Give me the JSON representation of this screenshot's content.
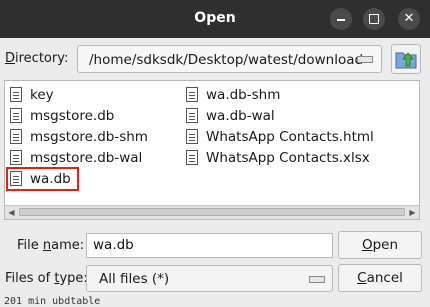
{
  "window": {
    "title": "Open"
  },
  "directory": {
    "label_prefix": "",
    "label_underlined": "D",
    "label_rest": "irectory:",
    "path": "/home/sdksdk/Desktop/watest/download"
  },
  "files": [
    {
      "name": "key"
    },
    {
      "name": "msgstore.db"
    },
    {
      "name": "msgstore.db-shm"
    },
    {
      "name": "msgstore.db-wal"
    },
    {
      "name": "wa.db",
      "highlighted": true
    },
    {
      "name": "wa.db-shm"
    },
    {
      "name": "wa.db-wal"
    },
    {
      "name": "WhatsApp Contacts.html"
    },
    {
      "name": "WhatsApp Contacts.xlsx"
    }
  ],
  "filename": {
    "label_prefix": "File ",
    "label_underlined": "n",
    "label_rest": "ame:",
    "value": "wa.db"
  },
  "filetype": {
    "label_prefix": "Files of ",
    "label_underlined": "t",
    "label_rest": "ype:",
    "value": "All files (*)"
  },
  "buttons": {
    "open": {
      "label_underlined": "O",
      "label_rest": "pen"
    },
    "cancel": {
      "label_underlined": "C",
      "label_rest": "ancel"
    }
  },
  "background_text": "201  min  ubdtable",
  "colors": {
    "highlight_border": "#e0221a",
    "titlebar": "#2f2f2f"
  },
  "icons": {
    "up_directory": "folder-up-icon",
    "file": "file-icon"
  }
}
